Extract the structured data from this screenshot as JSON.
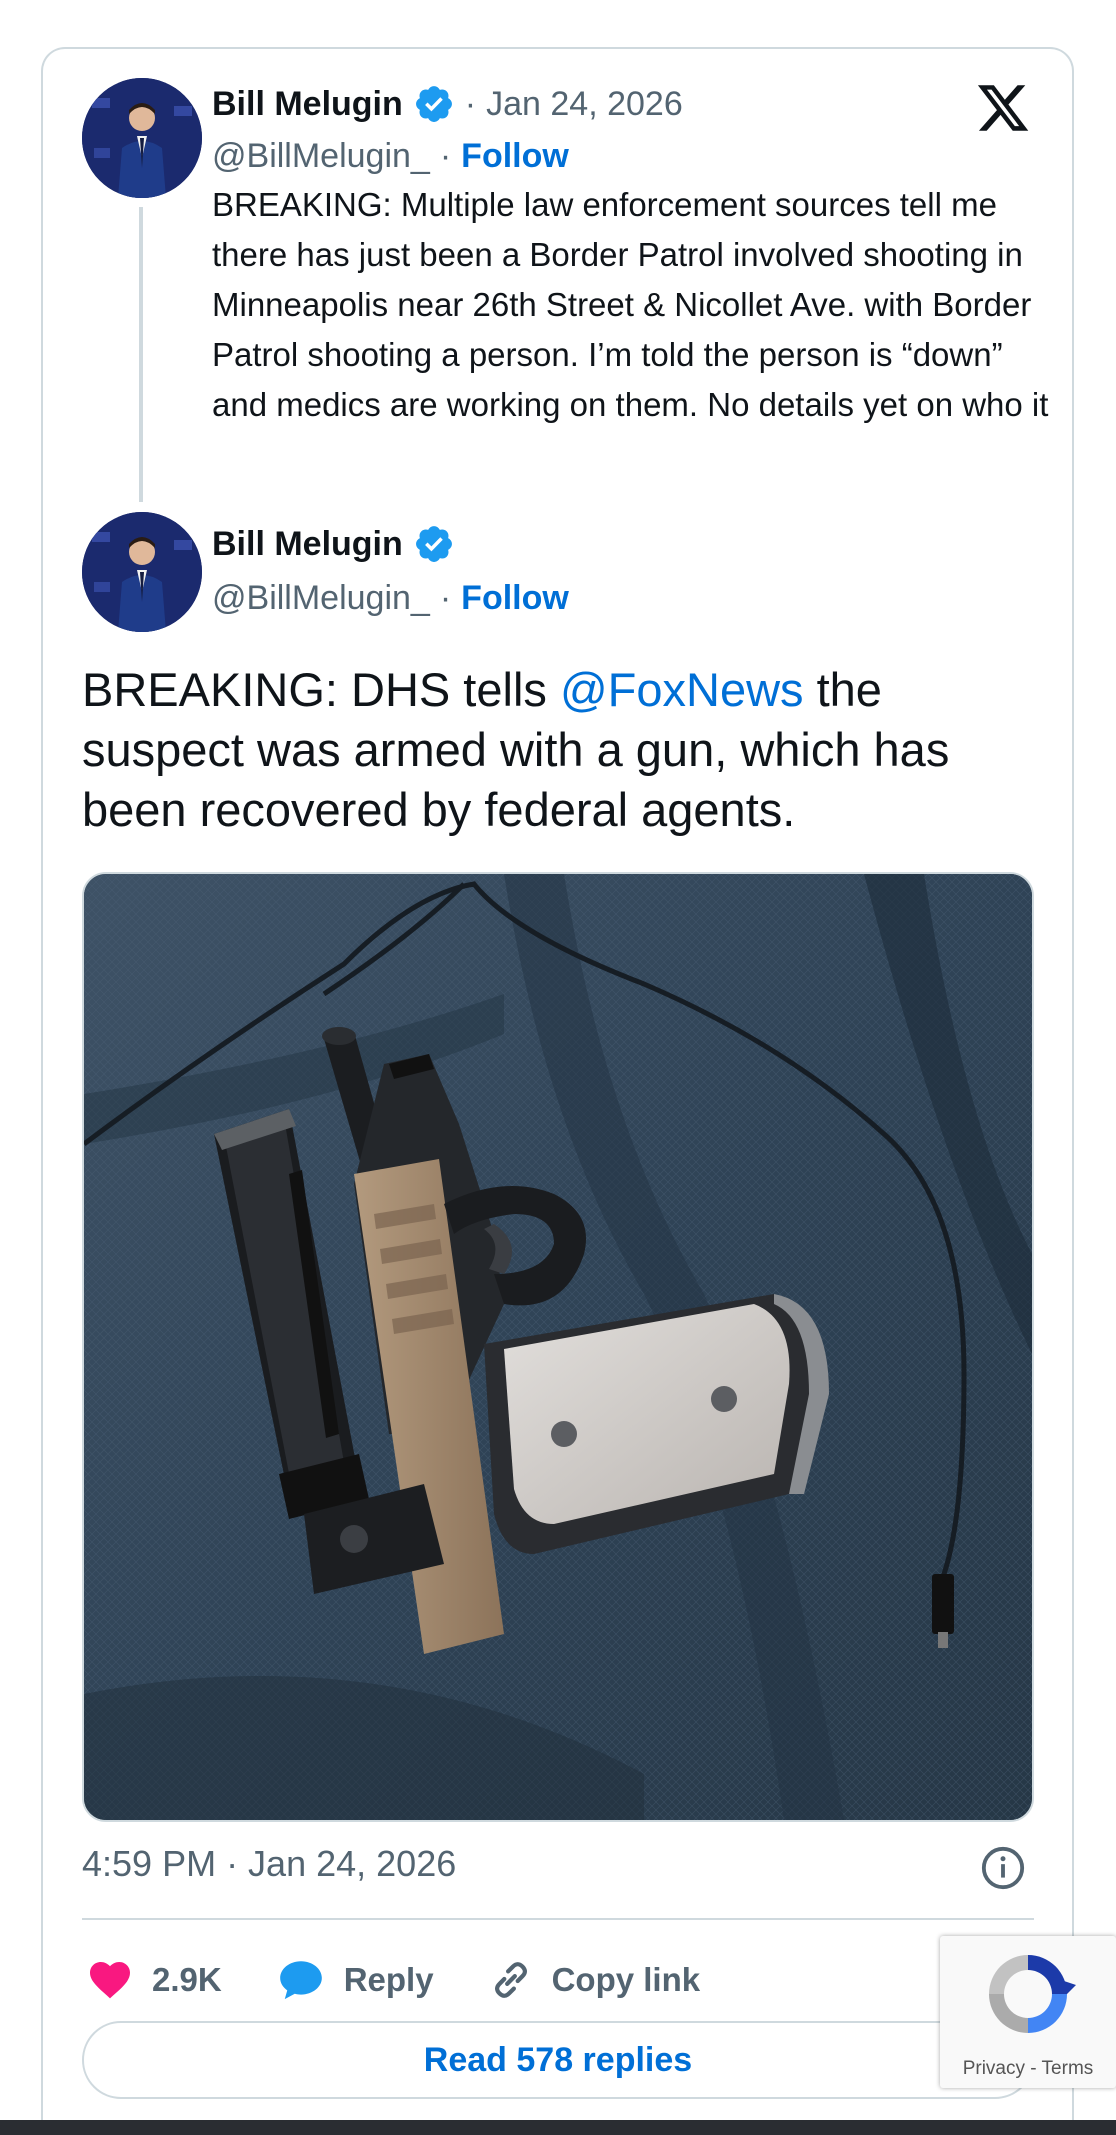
{
  "quoted_tweet": {
    "author_name": "Bill Melugin",
    "separator": "·",
    "date": "Jan 24, 2026",
    "handle": "@BillMelugin_",
    "follow_label": "Follow",
    "text": "BREAKING: Multiple law enforcement sources tell me there has just been a Border Patrol involved shooting in Minneapolis near 26th Street & Nicollet Ave. with Border Patrol shooting a person. I’m told the person is “down” and medics are working on them. No details yet on who it"
  },
  "tweet": {
    "author_name": "Bill Melugin",
    "separator": "·",
    "handle": "@BillMelugin_",
    "follow_label": "Follow",
    "text_before": "BREAKING: DHS tells ",
    "mention": "@FoxNews",
    "text_after": " the suspect was armed with a gun, which has been recovered by federal agents.",
    "timestamp": "4:59 PM · Jan 24, 2026"
  },
  "actions": {
    "like_count": "2.9K",
    "reply_label": "Reply",
    "copy_link_label": "Copy link",
    "read_replies_label": "Read 578 replies"
  },
  "recaptcha": {
    "privacy": "Privacy",
    "dash": " - ",
    "terms": "Terms"
  },
  "colors": {
    "link": "#006fd6",
    "like": "#f91880",
    "reply": "#1d9bf0",
    "verified": "#1d9bf0"
  }
}
